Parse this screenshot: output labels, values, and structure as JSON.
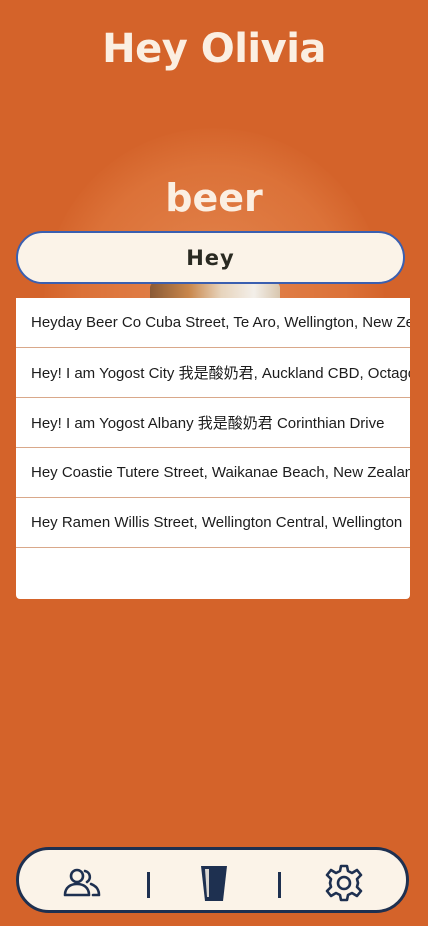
{
  "header": {
    "greeting": "Hey Olivia"
  },
  "category": {
    "label": "beer"
  },
  "search": {
    "value": "Hey"
  },
  "results": [
    "Heyday Beer Co Cuba Street, Te Aro, Wellington, New Zealand",
    "Hey! I am Yogost City 我是酸奶君, Auckland CBD, Octagon",
    "Hey! I am Yogost Albany 我是酸奶君 Corinthian Drive",
    "Hey Coastie Tutere Street, Waikanae Beach, New Zealand",
    "Hey Ramen Willis Street, Wellington Central, Wellington"
  ],
  "tabbar": {
    "icons": [
      "people-icon",
      "beer-glass-icon",
      "gear-icon"
    ],
    "colors": {
      "icon": "#1e3050",
      "background": "#fbf3e8"
    }
  },
  "colors": {
    "background": "#d4632a",
    "text_light": "#fbefe2",
    "search_border": "#3a5fb0"
  }
}
